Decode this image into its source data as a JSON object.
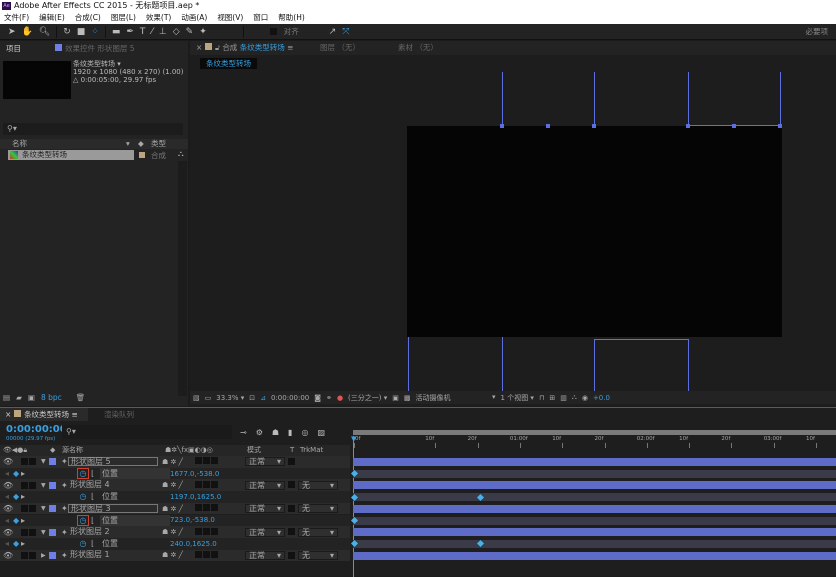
{
  "app": {
    "title": "Adobe After Effects CC 2015 - 无标题项目.aep *",
    "logo": "Ae"
  },
  "menu": [
    "文件(F)",
    "编辑(E)",
    "合成(C)",
    "图层(L)",
    "效果(T)",
    "动画(A)",
    "视图(V)",
    "窗口",
    "帮助(H)"
  ],
  "toolbar": {
    "snap_label": "对齐",
    "workspace": "必要项",
    "icons": [
      "selection-icon",
      "hand-icon",
      "zoom-icon",
      "rotate-icon",
      "camera-icon",
      "pan-behind-icon",
      "rectangle-icon",
      "pen-icon",
      "text-icon",
      "brush-icon",
      "clone-stamp-icon",
      "eraser-icon",
      "roto-brush-icon",
      "puppet-pin-icon"
    ]
  },
  "project_panel": {
    "tab": "项目",
    "effects_tab": "效果控件 形状图层 5",
    "comp_name": "条纹类型转场 ▾",
    "comp_size": "1920 x 1080  (480 x 270) (1.00)",
    "comp_duration": "△ 0:00:05:00, 29.97 fps",
    "col_name": "名称",
    "col_type": "类型",
    "items": [
      {
        "name": "条纹类型转场",
        "type": "合成"
      }
    ],
    "bpc": "8 bpc"
  },
  "viewer": {
    "comp_tab_prefix": "合成",
    "comp_tab": "条纹类型转场",
    "layer_tab": "图层 （无）",
    "footage_tab": "素材 （无）",
    "breadcrumb": "条纹类型转场",
    "zoom": "33.3%",
    "timecode": "0:00:00:00",
    "resolution": "(三分之一)",
    "camera": "活动摄像机",
    "views": "1 个视图",
    "exposure": "+0.0"
  },
  "timeline": {
    "tab": "条纹类型转场",
    "render_tab": "渲染队列",
    "timecode": "0:00:00:00",
    "frame_info": "00000 (29.97 fps)",
    "headers": {
      "name": "源名称",
      "mode": "模式",
      "t": "T",
      "trkmat": "TrkMat"
    },
    "ruler": [
      "0f",
      "10f",
      "20f",
      "01:00f",
      "10f",
      "20f",
      "02:00f",
      "10f",
      "20f",
      "03:00f",
      "10f",
      "20f"
    ],
    "rows": [
      {
        "kind": "layer",
        "name": "形状图层 5",
        "mode": "正常",
        "trkmat": "",
        "selected": true
      },
      {
        "kind": "prop",
        "name": "位置",
        "value": "1677.0,-538.0",
        "highlight": true
      },
      {
        "kind": "layer",
        "name": "形状图层 4",
        "mode": "正常",
        "trkmat": "无"
      },
      {
        "kind": "prop",
        "name": "位置",
        "value": "1197.0,1625.0"
      },
      {
        "kind": "layer",
        "name": "形状图层 3",
        "mode": "正常",
        "trkmat": "无",
        "selected": true
      },
      {
        "kind": "prop",
        "name": "位置",
        "value": "723.0,-538.0",
        "highlight": true
      },
      {
        "kind": "layer",
        "name": "形状图层 2",
        "mode": "正常",
        "trkmat": "无"
      },
      {
        "kind": "prop",
        "name": "位置",
        "value": "240.0,1625.0"
      },
      {
        "kind": "layer",
        "name": "形状图层 1",
        "mode": "正常",
        "trkmat": "无"
      }
    ]
  },
  "colors": {
    "accent": "#3aa0e0",
    "layer_label": "#6f7fe6",
    "shape_path": "#5d6fe0",
    "highlight_box": "#d04030"
  }
}
